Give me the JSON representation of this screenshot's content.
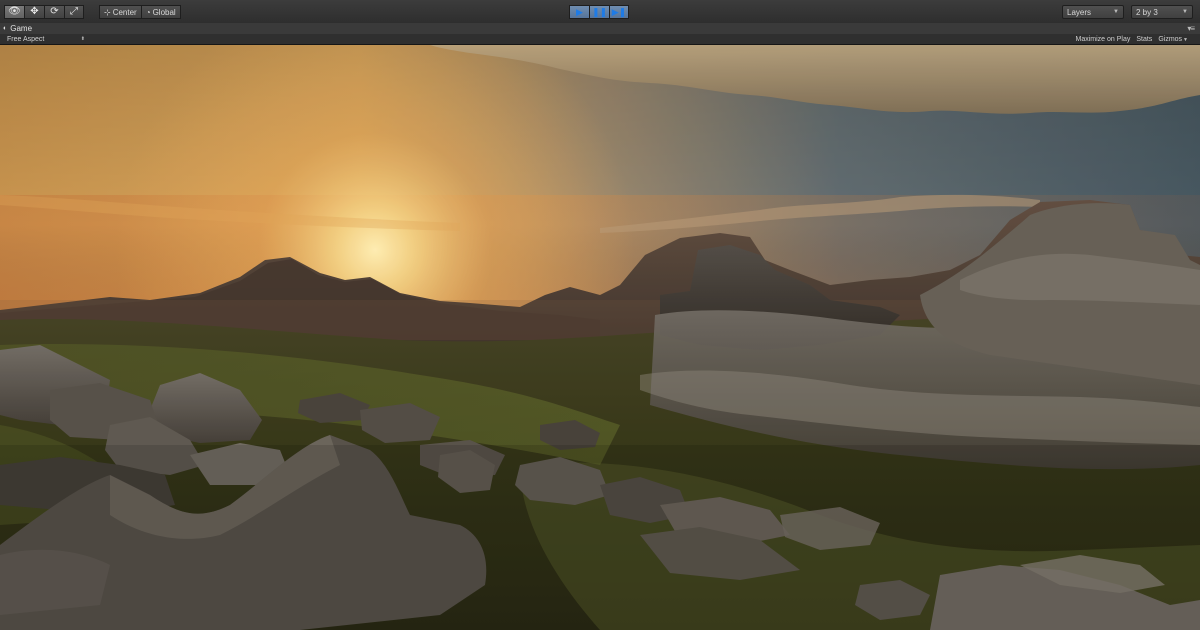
{
  "toolbar": {
    "transform_tools": [
      {
        "name": "view-tool-icon",
        "glyph": "👁"
      },
      {
        "name": "move-tool-icon",
        "glyph": "✥"
      },
      {
        "name": "rotate-tool-icon",
        "glyph": "⟳"
      },
      {
        "name": "scale-tool-icon",
        "glyph": "⤢"
      }
    ],
    "pivot_label": "Center",
    "pivot_icon": "pivot-icon",
    "space_label": "Global",
    "space_icon": "global-icon",
    "play_buttons": [
      {
        "name": "play-icon",
        "glyph": "▶"
      },
      {
        "name": "pause-icon",
        "glyph": "❚❚"
      },
      {
        "name": "step-icon",
        "glyph": "▶❚"
      }
    ],
    "layers_label": "Layers",
    "layout_label": "2 by 3"
  },
  "game_view": {
    "tab_label": "Game",
    "tab_icon": "game-controller-icon",
    "aspect_label": "Free Aspect",
    "maximize_label": "Maximize on Play",
    "stats_label": "Stats",
    "gizmos_label": "Gizmos"
  },
  "colors": {
    "play_accent": "#2f86e6",
    "toolbar_bg": "#3c3c3c",
    "sky_sun": "#f7d98a",
    "sky_blue": "#4f6471"
  }
}
